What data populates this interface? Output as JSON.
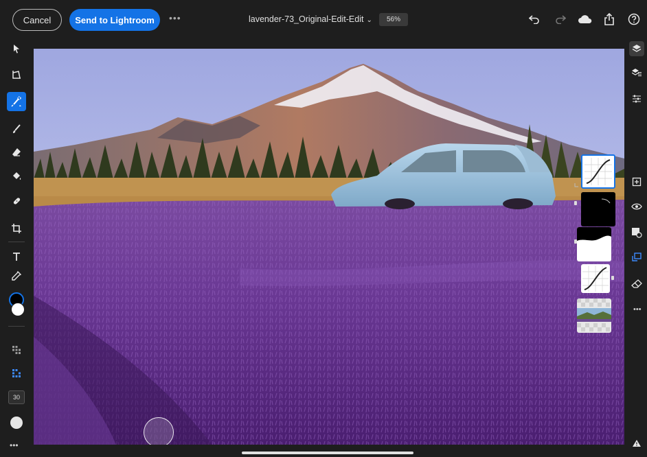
{
  "topbar": {
    "cancel_label": "Cancel",
    "send_label": "Send to Lightroom",
    "more_label": "•••",
    "document_title": "lavender-73_Original-Edit-Edit",
    "title_chevron": "⌄",
    "zoom_level": "56%"
  },
  "left_toolbar": {
    "brush_size": "30",
    "more_label": "•••",
    "active_tool": "quick-selection",
    "foreground_color": "#000000",
    "background_color": "#ffffff"
  },
  "right_toolbar": {
    "more_label": "•••",
    "active_tool": "layers"
  },
  "colors": {
    "accent": "#1473e6",
    "chrome": "#1e1e1e"
  }
}
